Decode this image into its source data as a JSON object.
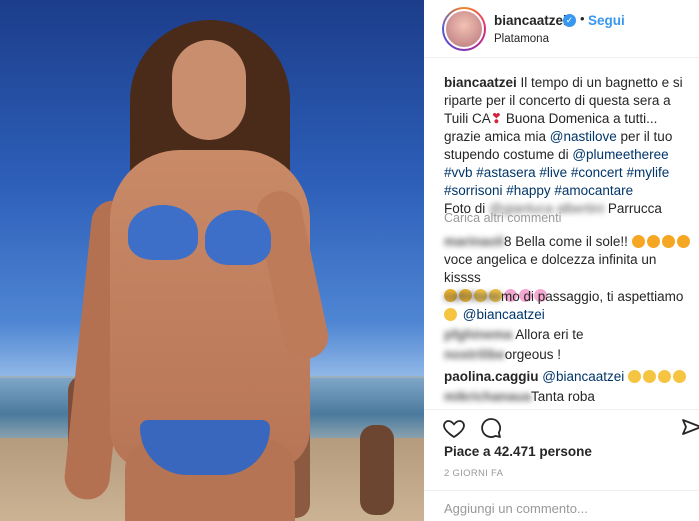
{
  "header": {
    "username": "biancaatzei",
    "verified_glyph": "✓",
    "separator": "•",
    "follow_label": "Segui",
    "location": "Platamona"
  },
  "caption": {
    "username": "biancaatzei",
    "text_1": " Il tempo di un bagnetto e si riparte per il concerto di questa sera a Tuili CA",
    "heart_emoji": "❣",
    "text_2": " Buona Domenica a tutti... grazie amica mia ",
    "mention_1": "@nastilove",
    "text_3": " per il tuo stupendo costume di ",
    "mention_2": "@plumeetheree",
    "hashtags": [
      "#vvb",
      "#astasera",
      "#live",
      "#concert",
      "#mylife",
      "#sorrisoni",
      "#happy",
      "#amocantare"
    ],
    "photo_credit_prefix": "Foto di",
    "photo_credit_suffix": "Parrucca"
  },
  "load_more_label": "Carica altri commenti",
  "comments": [
    {
      "user_blurred": "marinaoli",
      "text": "8 Bella come il sole!!",
      "emoji_line": "voce angelica e dolcezza infinita un kissss"
    },
    {
      "user_blurred": "cafritomi",
      "text": "mo di passaggio, ti aspettiamo ",
      "mention": "@biancaatzei"
    },
    {
      "user_blurred": "pfghinema",
      "text": "Allora eri te"
    },
    {
      "user_blurred": "nostrilibe",
      "text": "orgeous !"
    },
    {
      "user": "paolina.caggiu",
      "mention": "@biancaatzei"
    },
    {
      "user_blurred": "mikrichanaua",
      "text": "Tanta roba"
    }
  ],
  "actions": {
    "like_icon": "heart-icon",
    "comment_icon": "speech-bubble-icon",
    "share_icon": "share-icon"
  },
  "likes_text": "Piace a 42.471 persone",
  "timestamp": "2 GIORNI FA",
  "add_comment_placeholder": "Aggiungi un commento..."
}
